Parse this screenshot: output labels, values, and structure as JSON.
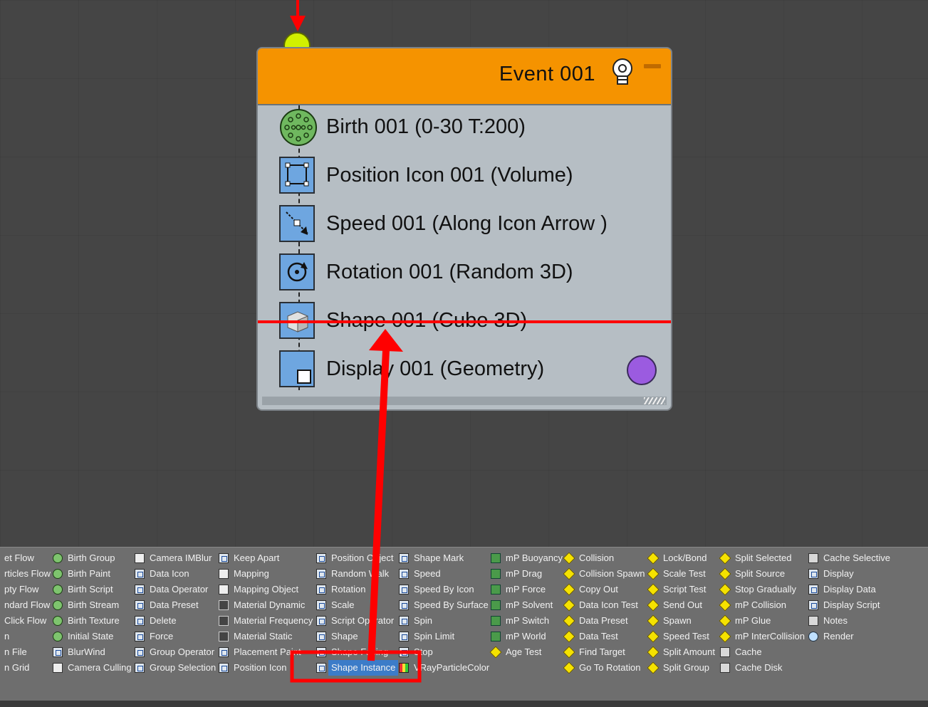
{
  "event": {
    "title": "Event 001",
    "operators": [
      {
        "label": "Birth 001 (0-30 T:200)",
        "icon": "birth-icon"
      },
      {
        "label": "Position Icon 001 (Volume)",
        "icon": "position-icon-icon"
      },
      {
        "label": "Speed 001 (Along Icon Arrow )",
        "icon": "speed-icon"
      },
      {
        "label": "Rotation 001 (Random 3D)",
        "icon": "rotation-icon"
      },
      {
        "label": "Shape 001 (Cube 3D)",
        "icon": "shape-icon"
      },
      {
        "label": "Display 001 (Geometry)",
        "icon": "display-icon"
      }
    ]
  },
  "depot": {
    "col1": [
      "et Flow",
      "rticles Flow",
      "pty Flow",
      "ndard Flow",
      " Click Flow",
      "n",
      "n File",
      "n Grid"
    ],
    "col2": [
      "Birth Group",
      "Birth Paint",
      "Birth Script",
      "Birth Stream",
      "Birth Texture",
      "Initial State",
      "BlurWind",
      "Camera Culling"
    ],
    "col3": [
      "Camera IMBlur",
      "Data Icon",
      "Data Operator",
      "Data Preset",
      "Delete",
      "Force",
      "Group Operator",
      "Group Selection"
    ],
    "col4": [
      "Keep Apart",
      "Mapping",
      "Mapping Object",
      "Material Dynamic",
      "Material Frequency",
      "Material Static",
      "Placement Paint",
      "Position Icon"
    ],
    "col5": [
      "Position Object",
      "Random Walk",
      "Rotation",
      "Scale",
      "Script Operator",
      "Shape",
      "Shape Facing",
      "Shape Instance"
    ],
    "col6": [
      "Shape Mark",
      "Speed",
      "Speed By Icon",
      "Speed By Surface",
      "Spin",
      "Spin Limit",
      "Stop",
      "VRayParticleColor"
    ],
    "col7": [
      "mP Buoyancy",
      "mP Drag",
      "mP Force",
      "mP Solvent",
      "mP Switch",
      "mP World",
      "Age Test"
    ],
    "col8": [
      "Collision",
      "Collision Spawn",
      "Copy Out",
      "Data Icon Test",
      "Data Preset",
      "Data Test",
      "Find Target",
      "Go To Rotation"
    ],
    "col9": [
      "Lock/Bond",
      "Scale Test",
      "Script Test",
      "Send Out",
      "Spawn",
      "Speed Test",
      "Split Amount",
      "Split Group"
    ],
    "col10": [
      "Split Selected",
      "Split Source",
      "Stop Gradually",
      "mP Collision",
      "mP Glue",
      "mP InterCollision",
      "Cache",
      "Cache Disk"
    ],
    "col11": [
      "Cache Selective",
      "Display",
      "Display Data",
      "Display Script",
      "Notes",
      "Render"
    ],
    "selected": "Shape Instance"
  },
  "colors": {
    "event_header": "#f59300",
    "event_body": "#b6bec4",
    "input_port": "#d2f000",
    "display_swatch": "#9b5be0",
    "annotation": "#ff0000",
    "selection": "#3c7cc8"
  }
}
